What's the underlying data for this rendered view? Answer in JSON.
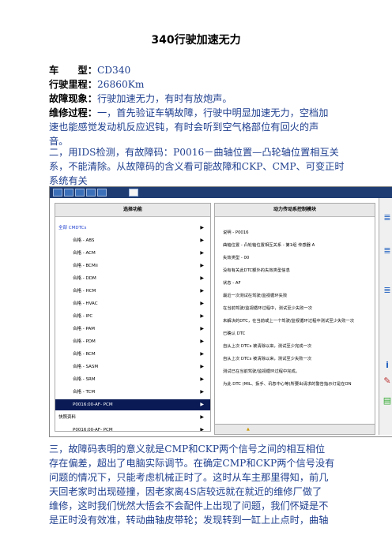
{
  "title": "340行驶加速无力",
  "fields": {
    "model_label": "车　　型：",
    "model_value": "CD340",
    "mileage_label": "行驶里程：",
    "mileage_value": "26860Km",
    "symptom_label": "故障现象：",
    "symptom_value": "行驶加速无力，有时有放炮声。",
    "process_label": "维修过程：",
    "process_line1": "一，首先验证车辆故障，行驶中明显加速无力，空档加",
    "process_line2": "速也能感觉发动机反应迟钝，有时会听到空气格部位有回火的声",
    "process_line3": "音。"
  },
  "para2": [
    "二，用IDS检测，有故障码：P0016－曲轴位置—凸轮轴位置相互关",
    "系，不能清除。从故障码的含义看可能故障和CKP、CMP、可变正时",
    "系统有关"
  ],
  "screenshot": {
    "left_header": "选择功能",
    "right_header": "动力传动系控制模块",
    "left_items": [
      {
        "label": "全部 CMDTCs",
        "indent": false,
        "link": true
      },
      {
        "label": "合格 - ABS",
        "indent": true
      },
      {
        "label": "合格 - ACM",
        "indent": true
      },
      {
        "label": "合格 - BCMii",
        "indent": true
      },
      {
        "label": "合格 - DDM",
        "indent": true
      },
      {
        "label": "合格 - HCM",
        "indent": true
      },
      {
        "label": "合格 - HVAC",
        "indent": true
      },
      {
        "label": "合格 - IPC",
        "indent": true
      },
      {
        "label": "合格 - PAM",
        "indent": true
      },
      {
        "label": "合格 - PDM",
        "indent": true
      },
      {
        "label": "合格 - RCM",
        "indent": true
      },
      {
        "label": "合格 - SASM",
        "indent": true
      },
      {
        "label": "合格 - SRM",
        "indent": true
      },
      {
        "label": "合格 - TCM",
        "indent": true
      },
      {
        "label": "P0016:00-AF- PCM",
        "indent": true,
        "selected": true
      },
      {
        "label": "快照资料",
        "indent": false
      },
      {
        "label": "P0016:00-AF- PCM",
        "indent": true
      }
    ],
    "right_lines": [
      "说明 - P0016",
      "曲轴位置 - 凸轮轴位置相互关系 - 第1组 传感器 A",
      "失效类型 - 00",
      "没有有关此DTC额外的失效类型信息",
      "状态 - AF",
      "最近一次测试在驾驶/监视循环失败",
      "在当前驾驶/监视循环过程中，测试至少失败一次",
      "未解决的DTC，在当前或上一个驾驶/监视循环过程中测试至少失败一次",
      "已确认 DTC",
      "自从上次 DTCs 被清除以来，测试至少完成一次",
      "自从上次 DTCs 被清除以来，测试至少失败一次",
      "测试已在当前驾驶/监视循环过程中完成。",
      "为此 DTC (MIL、扳手、讯息中心等)所要出请求的警告指示灯是在ON"
    ]
  },
  "para3": [
    "三，故障码表明的意义就是CMP和CKP两个信号之间的相互相位",
    "存在偏差，超出了电脑实际调节。在确定CMP和CKP两个信号没有",
    "问题的情况下，只能考虑机械正时了。这时从车主那里得知，前几",
    "天回老家时出现碰撞，因老家离4S店较远就在就近的维修厂做了",
    "维修，这时我们恍然大悟会不会配件上出现了问题，我们怀疑是不",
    "是正时没有效准，转动曲轴皮带轮；发现转到一缸上止点时，曲轴"
  ]
}
